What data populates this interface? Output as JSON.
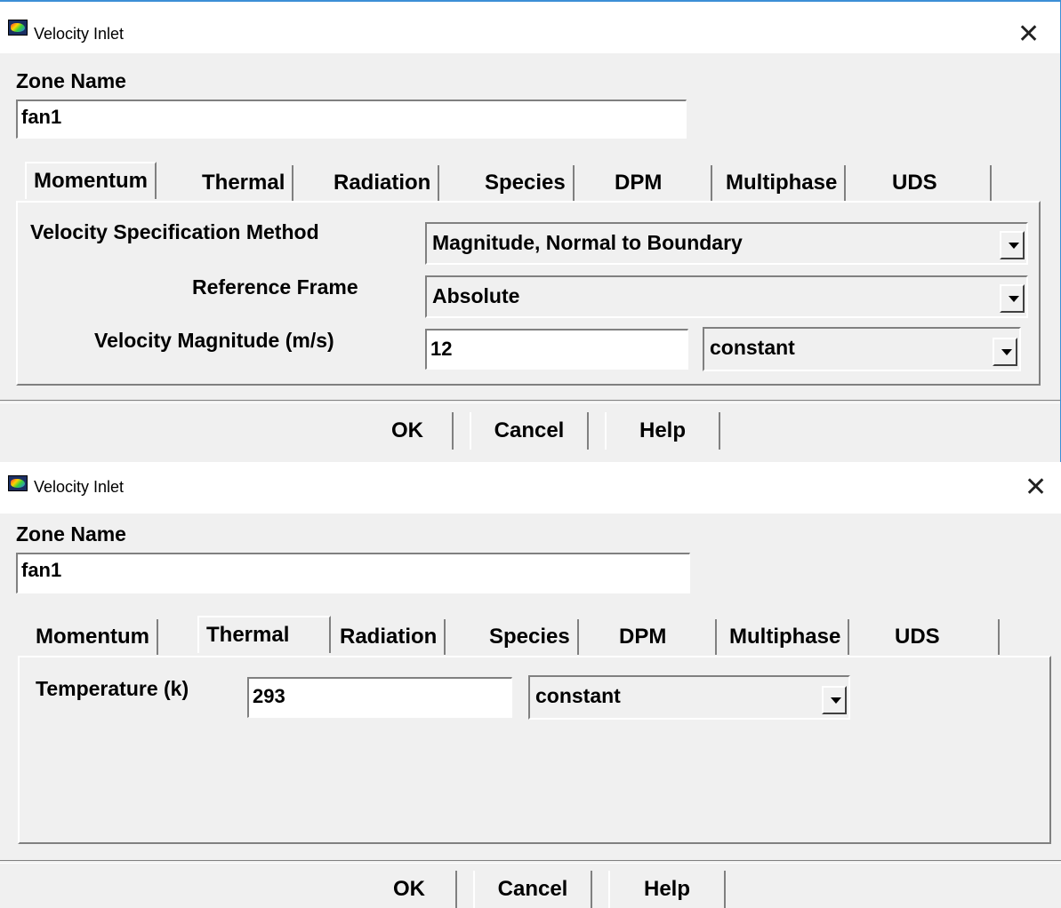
{
  "dialogs": [
    {
      "title": "Velocity Inlet",
      "zone_name_label": "Zone Name",
      "zone_name_value": "fan1",
      "tabs": [
        "Momentum",
        "Thermal",
        "Radiation",
        "Species",
        "DPM",
        "Multiphase",
        "UDS"
      ],
      "active_tab": "Momentum",
      "fields": {
        "velocity_spec_label": "Velocity Specification Method",
        "velocity_spec_value": "Magnitude, Normal to Boundary",
        "reference_frame_label": "Reference Frame",
        "reference_frame_value": "Absolute",
        "velocity_magnitude_label": "Velocity Magnitude (m/s)",
        "velocity_magnitude_value": "12",
        "velocity_magnitude_profile": "constant"
      },
      "buttons": {
        "ok": "OK",
        "cancel": "Cancel",
        "help": "Help"
      }
    },
    {
      "title": "Velocity Inlet",
      "zone_name_label": "Zone Name",
      "zone_name_value": "fan1",
      "tabs": [
        "Momentum",
        "Thermal",
        "Radiation",
        "Species",
        "DPM",
        "Multiphase",
        "UDS"
      ],
      "active_tab": "Thermal",
      "fields": {
        "temperature_label": "Temperature (k)",
        "temperature_value": "293",
        "temperature_profile": "constant"
      },
      "buttons": {
        "ok": "OK",
        "cancel": "Cancel",
        "help": "Help"
      }
    }
  ],
  "colors": {
    "window_bg": "#f0f0f0",
    "titlebar_bg": "#ffffff",
    "accent_border": "#3c8fd6"
  },
  "icons": {
    "app_icon": "fluent-app-icon",
    "close": "close-icon",
    "dropdown": "chevron-down-icon"
  }
}
